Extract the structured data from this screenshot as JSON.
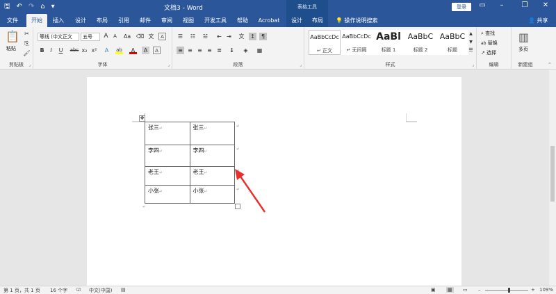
{
  "window": {
    "title": "文档3 - Word",
    "context_tab_group": "表格工具",
    "login_label": "登录",
    "min_icon": "–",
    "restore_icon": "❐",
    "close_icon": "✕",
    "ribbon_options_icon": "▭"
  },
  "quick_access": {
    "save_icon": "🖫",
    "undo_icon": "↶",
    "redo_icon": "↷",
    "touch_icon": "⌂",
    "customize_icon": "▾"
  },
  "tabs": [
    {
      "label": "文件"
    },
    {
      "label": "开始"
    },
    {
      "label": "插入"
    },
    {
      "label": "设计"
    },
    {
      "label": "布局"
    },
    {
      "label": "引用"
    },
    {
      "label": "邮件"
    },
    {
      "label": "审阅"
    },
    {
      "label": "视图"
    },
    {
      "label": "开发工具"
    },
    {
      "label": "帮助"
    },
    {
      "label": "Acrobat"
    },
    {
      "label": "设计"
    },
    {
      "label": "布局"
    }
  ],
  "tell_me": {
    "label": "操作说明搜索",
    "icon": "💡"
  },
  "share": {
    "label": "共享",
    "icon": "👤"
  },
  "ribbon": {
    "clipboard": {
      "label": "剪贴板",
      "paste_label": "粘贴",
      "paste_icon": "📋",
      "cut_icon": "✂",
      "copy_icon": "⎘",
      "format_painter_icon": "🖌"
    },
    "font": {
      "label": "字体",
      "font_name": "等线 (中文正文",
      "font_size": "五号",
      "grow_icon": "A",
      "shrink_icon": "A",
      "case_label": "Aa",
      "clear_format_icon": "⌫",
      "wen_icon": "文",
      "bold_icon": "B",
      "italic_icon": "I",
      "underline_icon": "U",
      "strike_label": "abc",
      "subscript_label": "x₂",
      "superscript_label": "x²",
      "effects_icon": "A",
      "highlight_icon": "ab",
      "color_icon": "A",
      "shading_icon": "A",
      "border_char_icon": "A"
    },
    "paragraph": {
      "label": "段落",
      "bullets_icon": "☰",
      "numbering_icon": "☷",
      "multilevel_icon": "☱",
      "decrease_indent_icon": "⇤",
      "increase_indent_icon": "⇥",
      "chinese_layout_icon": "文",
      "sort_icon": "↕",
      "marks_icon": "¶",
      "align_left_icon": "≡",
      "center_icon": "≡",
      "align_right_icon": "≡",
      "justify_icon": "≡",
      "distributed_icon": "≣",
      "line_spacing_icon": "↨",
      "shading_icon": "◈",
      "borders_icon": "▦"
    },
    "styles": {
      "label": "样式",
      "items": [
        {
          "sample": "AaBbCcDc",
          "name": "↵ 正文"
        },
        {
          "sample": "AaBbCcDc",
          "name": "↵ 无间隔"
        },
        {
          "sample": "AaBl",
          "name": "标题 1"
        },
        {
          "sample": "AaBbC",
          "name": "标题 2"
        },
        {
          "sample": "AaBbC",
          "name": "标题"
        }
      ],
      "scroll_up_icon": "▲",
      "scroll_down_icon": "▼",
      "more_icon": "☰"
    },
    "editing": {
      "label": "编辑",
      "find_label": "查找",
      "find_icon": "⌕",
      "replace_label": "替换",
      "replace_icon": "ab",
      "select_label": "选择",
      "select_icon": "➚"
    },
    "new_group": {
      "label": "新建组",
      "multipage_label": "多页",
      "multipage_icon": "▥"
    }
  },
  "document": {
    "table_move_icon": "✥",
    "table": [
      [
        "张三",
        "张三"
      ],
      [
        "李四",
        "李四"
      ],
      [
        "老王",
        "老王"
      ],
      [
        "小张",
        "小张"
      ]
    ],
    "cell_mark": "↵",
    "para_mark": "↵"
  },
  "statusbar": {
    "page": "第 1 页，共 1 页",
    "words": "16 个字",
    "proof_icon": "☑",
    "language": "中文(中国)",
    "macro_icon": "▤",
    "read_mode_icon": "▣",
    "print_layout_icon": "▦",
    "web_layout_icon": "▭",
    "zoom_out": "–",
    "zoom_in": "+",
    "zoom": "109%",
    "zoom_level": 0.55
  },
  "colors": {
    "word_blue": "#2b579a",
    "arrow_red": "#e8312f"
  }
}
